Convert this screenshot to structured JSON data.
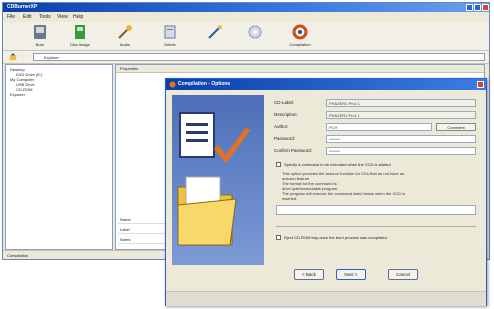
{
  "main": {
    "title": "CDBurnerXP",
    "menu": [
      "File",
      "Edit",
      "Tools",
      "View",
      "Help"
    ],
    "toolbar": [
      "Burn",
      "Disc image",
      "Audio",
      "Delete",
      "Compilation"
    ],
    "address": "Explorer",
    "tree": [
      "Desktop",
      "DVD Drive (E:)",
      "My Computer",
      "USB Drive",
      "CD-ROM",
      "Explorer"
    ],
    "list_header": "Properties",
    "props": [
      "Name",
      "Label",
      "Notes"
    ],
    "status": "Compilation"
  },
  "dialog": {
    "title": "Compilation - Options",
    "labels": {
      "cd_label": "CD-Label:",
      "description": "Description:",
      "author": "Author:",
      "password": "Password:",
      "confirm_password": "Confirm Password:"
    },
    "values": {
      "cd_label": "PHAZER1 Pro1 L",
      "description": "PHAZER1 Pro1 L",
      "author": "PCH",
      "password": "*******",
      "confirm_password": "*******"
    },
    "comment_button": "Comment",
    "checkbox1": "Specify a command to be executed when the VCD is started",
    "help_lines": [
      "This option provides the autorun function for CDs that do not have an",
      "autorun feature",
      "The format for the command is:",
      "drive:\\path\\executable.program",
      "The program will execute the command listed below when the VCD is",
      "inserted."
    ],
    "checkbox2": "Eject CD-ROM tray once the burn process was completed.",
    "buttons": {
      "back": "< Back",
      "next": "Next >",
      "cancel": "Cancel"
    }
  },
  "colors": {
    "accent": "#0a3fa8",
    "checkmark": "#e8701a",
    "folder": "#f0c040"
  }
}
